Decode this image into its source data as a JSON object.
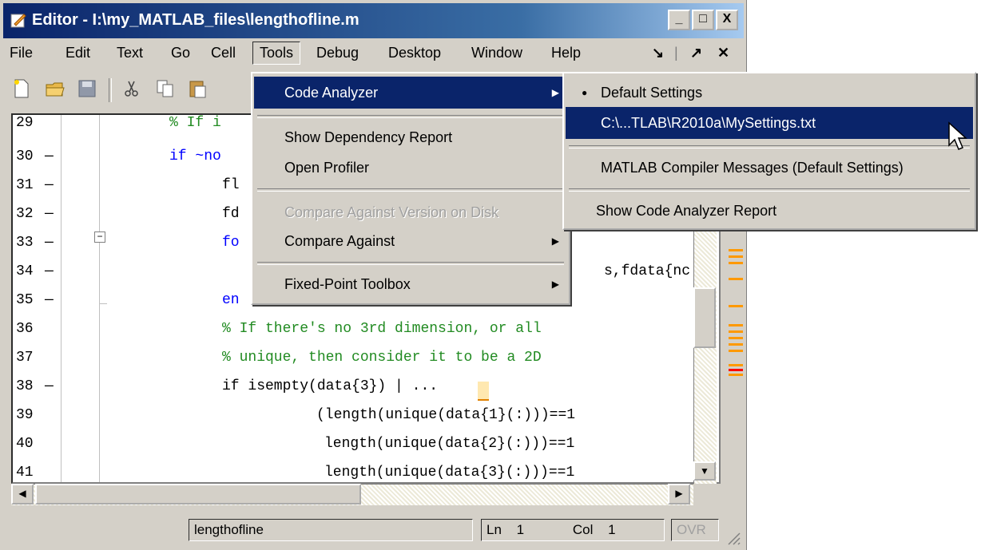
{
  "window": {
    "title": "Editor - I:\\my_MATLAB_files\\lengthofline.m",
    "minimize_label": "_",
    "maximize_label": "□",
    "close_label": "X"
  },
  "menubar": {
    "items": [
      "File",
      "Edit",
      "Text",
      "Go",
      "Cell",
      "Tools",
      "Debug",
      "Desktop",
      "Window",
      "Help"
    ],
    "undock_label": "↘",
    "dock_label": "↗",
    "close_label": "✕"
  },
  "editor": {
    "lines": [
      {
        "num": "29",
        "dash": "",
        "code": "% If i"
      },
      {
        "num": "30",
        "dash": "—",
        "code": "if ~no"
      },
      {
        "num": "31",
        "dash": "—",
        "code": "fl"
      },
      {
        "num": "32",
        "dash": "—",
        "code": "fd"
      },
      {
        "num": "33",
        "dash": "—",
        "code": "fo"
      },
      {
        "num": "34",
        "dash": "—",
        "code": "s,fdata{nc"
      },
      {
        "num": "35",
        "dash": "—",
        "code": "en"
      },
      {
        "num": "36",
        "dash": "",
        "code": "% If there's no 3rd dimension, or all"
      },
      {
        "num": "37",
        "dash": "",
        "code": "% unique, then consider it to be a 2D"
      },
      {
        "num": "38",
        "dash": "—",
        "code": "if isempty(data{3}) | ..."
      },
      {
        "num": "39",
        "dash": "",
        "code": "(length(unique(data{1}(:)))==1"
      },
      {
        "num": "40",
        "dash": "",
        "code": "length(unique(data{2}(:)))==1"
      },
      {
        "num": "41",
        "dash": "",
        "code": "length(unique(data{3}(:)))==1"
      }
    ],
    "fold_marker": "−"
  },
  "tools_menu": {
    "items": [
      {
        "label": "Code Analyzer",
        "state": "highlighted",
        "submenu": true
      },
      {
        "label": "Show Dependency Report",
        "state": "normal",
        "submenu": false
      },
      {
        "label": "Open Profiler",
        "state": "normal",
        "submenu": false
      },
      {
        "label": "Compare Against Version on Disk",
        "state": "disabled",
        "submenu": false
      },
      {
        "label": "Compare Against",
        "state": "normal",
        "submenu": true
      },
      {
        "label": "Fixed-Point Toolbox",
        "state": "normal",
        "submenu": true
      }
    ]
  },
  "code_analyzer_menu": {
    "items": [
      {
        "label": "Default Settings",
        "state": "checked"
      },
      {
        "label": "C:\\...TLAB\\R2010a\\MySettings.txt",
        "state": "highlighted"
      },
      {
        "label": "MATLAB Compiler Messages (Default Settings)",
        "state": "normal"
      },
      {
        "label": "Show Code Analyzer Report",
        "state": "normal"
      }
    ],
    "bullet": "●"
  },
  "statusbar": {
    "filename": "lengthofline",
    "ln_label": "Ln",
    "ln_value": "1",
    "col_label": "Col",
    "col_value": "1",
    "ovr_label": "OVR"
  },
  "colors": {
    "title_gradient_start": "#0a246a",
    "highlight": "#0a246a",
    "keyword": "#0000ff",
    "comment": "#228b22",
    "warning_marker": "#ff9900",
    "error_marker": "#ff0000"
  }
}
